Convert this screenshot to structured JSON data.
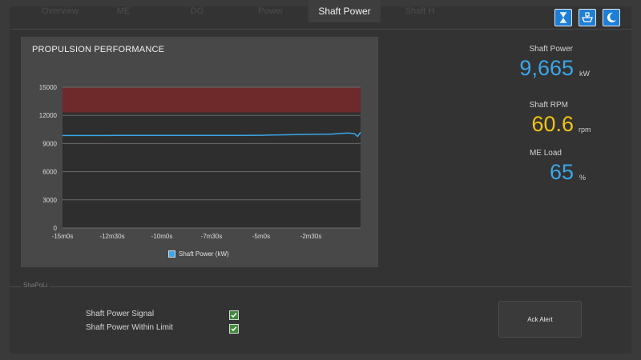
{
  "tabs": [
    {
      "label": "Overview",
      "active": false
    },
    {
      "label": "ME",
      "active": false
    },
    {
      "label": "DG",
      "active": false
    },
    {
      "label": "Power",
      "active": false
    },
    {
      "label": "Shaft Power",
      "active": true
    },
    {
      "label": "Shaft H",
      "active": false
    }
  ],
  "toolbar": {
    "icons": [
      "hourglass-icon",
      "ship-icon",
      "moon-icon"
    ]
  },
  "chart": {
    "title": "PROPULSION PERFORMANCE",
    "legend": "Shaft Power (kW)"
  },
  "chart_data": {
    "type": "line",
    "title": "PROPULSION PERFORMANCE",
    "x_ticks": [
      "-15m0s",
      "-12m30s",
      "-10m0s",
      "-7m30s",
      "-5m0s",
      "-2m30s"
    ],
    "y_ticks": [
      "15000",
      "12000",
      "9000",
      "6000",
      "3000",
      "0"
    ],
    "ylim": [
      0,
      15000
    ],
    "xlim_minutes": [
      -15,
      0
    ],
    "grid": true,
    "legend_placement": "bottom-center",
    "alarm_band": {
      "from": 12300,
      "to": 15000,
      "color": "#6e2a2a"
    },
    "series": [
      {
        "name": "Shaft Power (kW)",
        "color": "#3aa6e8",
        "x_minutes": [
          -15,
          -14,
          -13,
          -12,
          -11,
          -10,
          -9,
          -8,
          -7,
          -6,
          -5,
          -4.5,
          -4,
          -3.5,
          -3,
          -2.5,
          -2,
          -1.5,
          -1,
          -0.6,
          -0.3,
          -0.15,
          0
        ],
        "values": [
          9850,
          9850,
          9850,
          9860,
          9860,
          9860,
          9860,
          9860,
          9860,
          9870,
          9880,
          9900,
          9920,
          9940,
          9960,
          9980,
          10000,
          9990,
          10080,
          10120,
          10050,
          9750,
          10200
        ]
      }
    ]
  },
  "metrics": {
    "shaft_power": {
      "label": "Shaft Power",
      "value": "9,665",
      "unit": "kW",
      "color": "#3aa6e8"
    },
    "shaft_rpm": {
      "label": "Shaft RPM",
      "value": "60.6",
      "unit": "rpm",
      "color": "#f2c40f"
    },
    "me_load": {
      "label": "ME Load",
      "value": "65",
      "unit": "%",
      "color": "#3aa6e8"
    }
  },
  "section": {
    "label": "ShaPoLi",
    "signals": [
      {
        "label": "Shaft Power Signal",
        "checked": true
      },
      {
        "label": "Shaft Power Within Limit",
        "checked": true
      }
    ],
    "ack_button": "Ack Alert"
  }
}
